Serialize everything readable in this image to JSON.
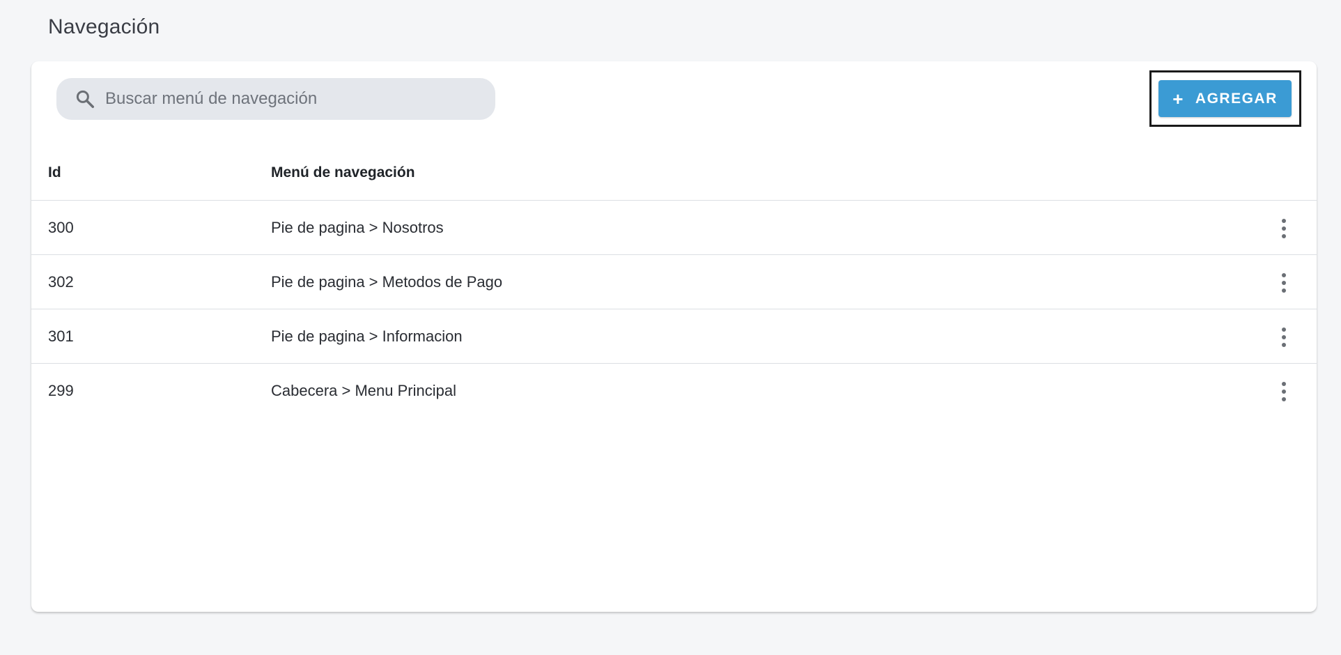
{
  "header": {
    "title": "Navegación"
  },
  "toolbar": {
    "search_placeholder": "Buscar menú de navegación",
    "search_value": "",
    "search_icon": "search-icon",
    "add_icon": "plus-icon",
    "add_symbol": "+",
    "add_label": "AGREGAR",
    "accent_color": "#3b9bd4"
  },
  "table": {
    "columns": [
      "Id",
      "Menú de navegación"
    ],
    "rows": [
      {
        "id": "300",
        "menu": "Pie de pagina > Nosotros"
      },
      {
        "id": "302",
        "menu": "Pie de pagina > Metodos de Pago"
      },
      {
        "id": "301",
        "menu": "Pie de pagina > Informacion"
      },
      {
        "id": "299",
        "menu": "Cabecera > Menu Principal"
      }
    ],
    "row_action_icon": "more-vertical-icon"
  }
}
